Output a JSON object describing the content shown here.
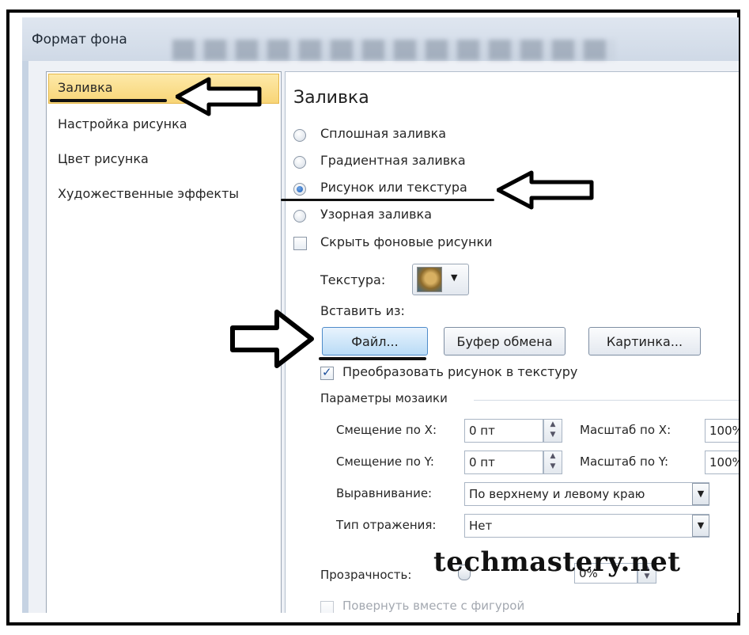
{
  "dialog": {
    "title": "Формат фона"
  },
  "sidebar": {
    "items": [
      {
        "label": "Заливка",
        "selected": true
      },
      {
        "label": "Настройка рисунка"
      },
      {
        "label": "Цвет рисунка"
      },
      {
        "label": "Художественные эффекты"
      }
    ]
  },
  "fill": {
    "heading": "Заливка",
    "options": [
      {
        "label": "Сплошная заливка",
        "checked": false
      },
      {
        "label": "Градиентная заливка",
        "checked": false
      },
      {
        "label": "Рисунок или текстура",
        "checked": true
      },
      {
        "label": "Узорная заливка",
        "checked": false
      }
    ],
    "hide_bg_label": "Скрыть фоновые рисунки",
    "texture_label": "Текстура:",
    "insert_from_label": "Вставить из:",
    "buttons": {
      "file": "Файл...",
      "clipboard": "Буфер обмена",
      "clipart": "Картинка..."
    },
    "tile_label": "Преобразовать рисунок в текстуру",
    "tiling_group": "Параметры мозаики",
    "offset_x_label": "Смещение по X:",
    "offset_x_value": "0 пт",
    "scale_x_label": "Масштаб по X:",
    "scale_x_value": "100%",
    "offset_y_label": "Смещение по Y:",
    "offset_y_value": "0 пт",
    "scale_y_label": "Масштаб по Y:",
    "scale_y_value": "100%",
    "align_label": "Выравнивание:",
    "align_value": "По верхнему и левому краю",
    "mirror_label": "Тип отражения:",
    "mirror_value": "Нет",
    "transparency_label": "Прозрачность:",
    "transparency_value": "0%",
    "rotate_label": "Повернуть вместе с фигурой"
  },
  "watermark": "techmastery.net",
  "colors": {
    "selected_bg": "#f8d577",
    "accent": "#1f5fb5"
  }
}
